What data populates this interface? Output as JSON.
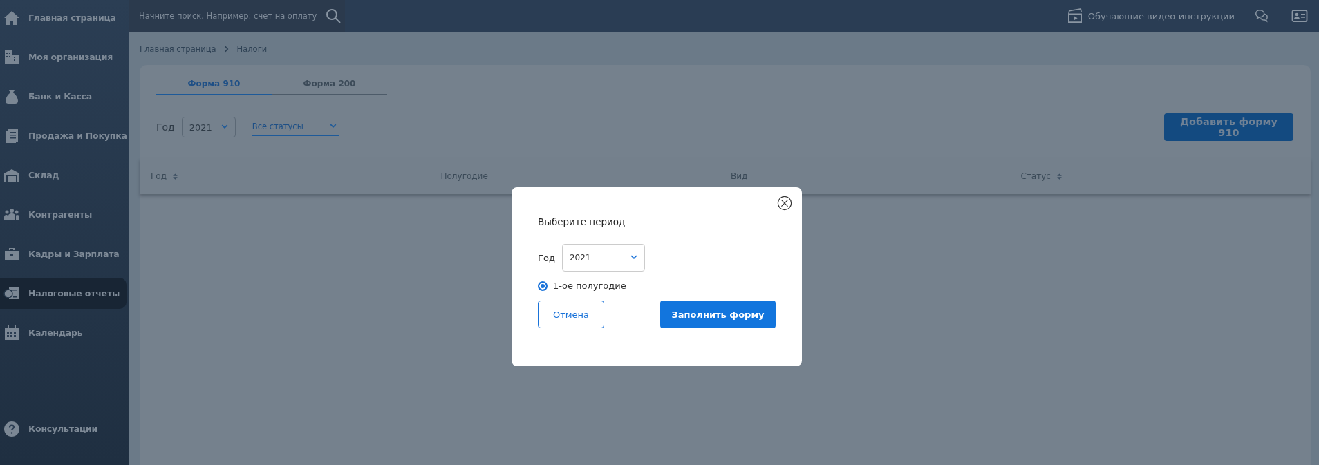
{
  "sidebar": {
    "items": [
      {
        "label": "Главная страница",
        "selected": false
      },
      {
        "label": "Моя организация",
        "selected": false
      },
      {
        "label": "Банк и Касса",
        "selected": false
      },
      {
        "label": "Продажа и Покупка",
        "selected": false
      },
      {
        "label": "Склад",
        "selected": false
      },
      {
        "label": "Контрагенты",
        "selected": false
      },
      {
        "label": "Кадры и Зарплата",
        "selected": false
      },
      {
        "label": "Налоговые отчеты",
        "selected": true
      },
      {
        "label": "Календарь",
        "selected": false
      }
    ],
    "bottom_item": {
      "label": "Консультации",
      "selected": false
    }
  },
  "top_bar": {
    "search": {
      "placeholder": "Начните поиск. Например: счет на оплату"
    },
    "video_link": "Обучающие видео-инструкции"
  },
  "breadcrumb": [
    "Главная страница",
    "Налоги"
  ],
  "tabs": [
    {
      "label": "Форма 910",
      "selected": true
    },
    {
      "label": "Форма 200",
      "selected": false
    }
  ],
  "filters": {
    "year_label": "Год",
    "year_value": "2021",
    "status_value": "Все статусы"
  },
  "add_button": "Добавить форму 910",
  "table": {
    "columns": [
      {
        "label": "Год",
        "sortable": true
      },
      {
        "label": "Полугодие",
        "sortable": false
      },
      {
        "label": "Вид",
        "sortable": false
      },
      {
        "label": "Статус",
        "sortable": true
      }
    ]
  },
  "modal": {
    "title": "Выберите период",
    "year_label": "Год",
    "year_value": "2021",
    "options": [
      {
        "label": "1-ое полугодие",
        "selected": true
      }
    ],
    "cancel_button": "Отмена",
    "submit_button": "Заполнить форму"
  }
}
